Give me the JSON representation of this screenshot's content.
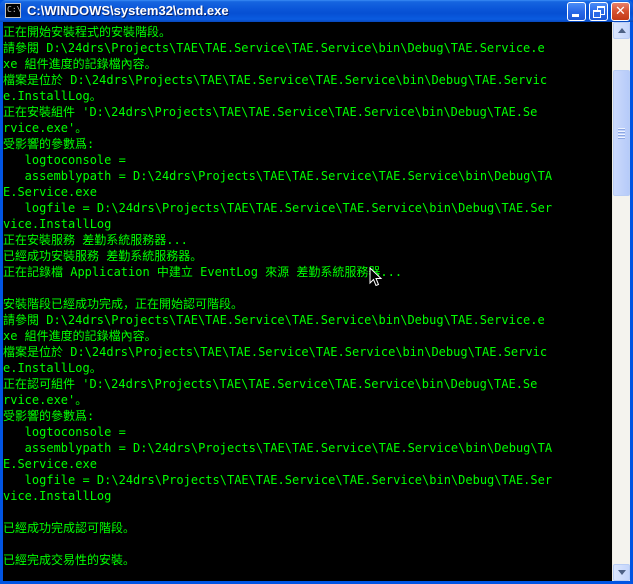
{
  "window": {
    "title": "C:\\WINDOWS\\system32\\cmd.exe",
    "icon": "console-app-icon",
    "icon_glyph": "C:\\",
    "buttons": {
      "minimize_icon": "minimize-icon",
      "restore_icon": "restore-icon",
      "close_icon": "close-icon",
      "close_glyph": "✕"
    }
  },
  "console": {
    "text_color": "#00ff00",
    "background": "#000000",
    "lines": [
      "正在開始安裝程式的安裝階段。",
      "請參閱 D:\\24drs\\Projects\\TAE\\TAE.Service\\TAE.Service\\bin\\Debug\\TAE.Service.e",
      "xe 組件進度的記錄檔內容。",
      "檔案是位於 D:\\24drs\\Projects\\TAE\\TAE.Service\\TAE.Service\\bin\\Debug\\TAE.Servic",
      "e.InstallLog。",
      "正在安裝組件 'D:\\24drs\\Projects\\TAE\\TAE.Service\\TAE.Service\\bin\\Debug\\TAE.Se",
      "rvice.exe'。",
      "受影響的參數爲:",
      "   logtoconsole =",
      "   assemblypath = D:\\24drs\\Projects\\TAE\\TAE.Service\\TAE.Service\\bin\\Debug\\TA",
      "E.Service.exe",
      "   logfile = D:\\24drs\\Projects\\TAE\\TAE.Service\\TAE.Service\\bin\\Debug\\TAE.Ser",
      "vice.InstallLog",
      "正在安裝服務 差勤系統服務器...",
      "已經成功安裝服務 差勤系統服務器。",
      "正在記錄檔 Application 中建立 EventLog 來源 差勤系統服務器...",
      "",
      "安裝階段已經成功完成，正在開始認可階段。",
      "請參閱 D:\\24drs\\Projects\\TAE\\TAE.Service\\TAE.Service\\bin\\Debug\\TAE.Service.e",
      "xe 組件進度的記錄檔內容。",
      "檔案是位於 D:\\24drs\\Projects\\TAE\\TAE.Service\\TAE.Service\\bin\\Debug\\TAE.Servic",
      "e.InstallLog。",
      "正在認可組件 'D:\\24drs\\Projects\\TAE\\TAE.Service\\TAE.Service\\bin\\Debug\\TAE.Se",
      "rvice.exe'。",
      "受影響的參數爲:",
      "   logtoconsole =",
      "   assemblypath = D:\\24drs\\Projects\\TAE\\TAE.Service\\TAE.Service\\bin\\Debug\\TA",
      "E.Service.exe",
      "   logfile = D:\\24drs\\Projects\\TAE\\TAE.Service\\TAE.Service\\bin\\Debug\\TAE.Ser",
      "vice.InstallLog",
      "",
      "已經成功完成認可階段。",
      "",
      "已經完成交易性的安裝。"
    ]
  },
  "scrollbar": {
    "up_icon": "scroll-up-arrow-icon",
    "down_icon": "scroll-down-arrow-icon"
  },
  "cursor": {
    "icon": "mouse-pointer-icon"
  }
}
